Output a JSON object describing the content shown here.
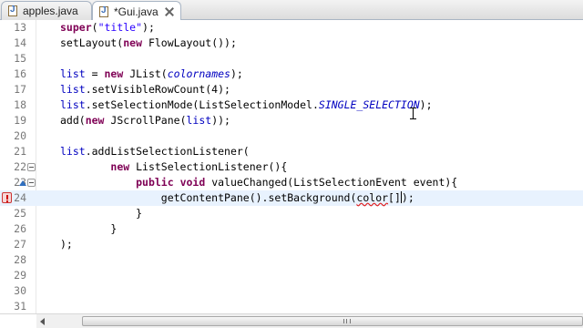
{
  "tabs": [
    {
      "label": "apples.java"
    },
    {
      "label": "*Gui.java",
      "active": true
    }
  ],
  "colors": {
    "keyword": "#7f0055",
    "string": "#2a00ff",
    "field": "#0000c0",
    "line_number": "#787878",
    "current_line": "#e8f2fe",
    "error_underline": "#e02020"
  },
  "editor": {
    "current_line": "24",
    "lines": [
      {
        "num": "13",
        "tokens": [
          {
            "t": "super",
            "c": "kw"
          },
          {
            "t": "("
          },
          {
            "t": "\"title\"",
            "c": "str"
          },
          {
            "t": ");"
          }
        ]
      },
      {
        "num": "14",
        "tokens": [
          {
            "t": "setLayout("
          },
          {
            "t": "new",
            "c": "kw"
          },
          {
            "t": " FlowLayout());"
          }
        ]
      },
      {
        "num": "15",
        "tokens": []
      },
      {
        "num": "16",
        "tokens": [
          {
            "t": "list",
            "c": "fld"
          },
          {
            "t": " = "
          },
          {
            "t": "new",
            "c": "kw"
          },
          {
            "t": " JList("
          },
          {
            "t": "colornames",
            "c": "ital"
          },
          {
            "t": ");"
          }
        ]
      },
      {
        "num": "17",
        "tokens": [
          {
            "t": "list",
            "c": "fld"
          },
          {
            "t": ".setVisibleRowCount(4);"
          }
        ]
      },
      {
        "num": "18",
        "tokens": [
          {
            "t": "list",
            "c": "fld"
          },
          {
            "t": ".setSelectionMode(ListSelectionModel."
          },
          {
            "t": "SINGLE_SELECTION",
            "c": "ital"
          },
          {
            "t": ");"
          }
        ]
      },
      {
        "num": "19",
        "tokens": [
          {
            "t": "add("
          },
          {
            "t": "new",
            "c": "kw"
          },
          {
            "t": " JScrollPane("
          },
          {
            "t": "list",
            "c": "fld"
          },
          {
            "t": "));"
          }
        ]
      },
      {
        "num": "20",
        "tokens": []
      },
      {
        "num": "21",
        "tokens": [
          {
            "t": "list",
            "c": "fld"
          },
          {
            "t": ".addListSelectionListener("
          }
        ]
      },
      {
        "num": "22",
        "tokens": [
          {
            "t": "        "
          },
          {
            "t": "new",
            "c": "kw"
          },
          {
            "t": " ListSelectionListener(){"
          }
        ],
        "fold": true
      },
      {
        "num": "23",
        "tokens": [
          {
            "t": "            "
          },
          {
            "t": "public",
            "c": "kw"
          },
          {
            "t": " "
          },
          {
            "t": "void",
            "c": "kw"
          },
          {
            "t": " valueChanged(ListSelectionEvent event){"
          }
        ],
        "fold": true,
        "override": true
      },
      {
        "num": "24",
        "tokens": [
          {
            "t": "                getContentPane().setBackground("
          },
          {
            "t": "color",
            "c": "err"
          },
          {
            "t": "[]"
          },
          {
            "t": "|",
            "c": "caret"
          },
          {
            "t": ");"
          }
        ],
        "error": true
      },
      {
        "num": "25",
        "tokens": [
          {
            "t": "            }"
          }
        ]
      },
      {
        "num": "26",
        "tokens": [
          {
            "t": "        }"
          }
        ]
      },
      {
        "num": "27",
        "tokens": [
          {
            "t": ");"
          }
        ]
      },
      {
        "num": "28",
        "tokens": []
      },
      {
        "num": "29",
        "tokens": []
      },
      {
        "num": "30",
        "tokens": []
      },
      {
        "num": "31",
        "tokens": []
      }
    ]
  }
}
